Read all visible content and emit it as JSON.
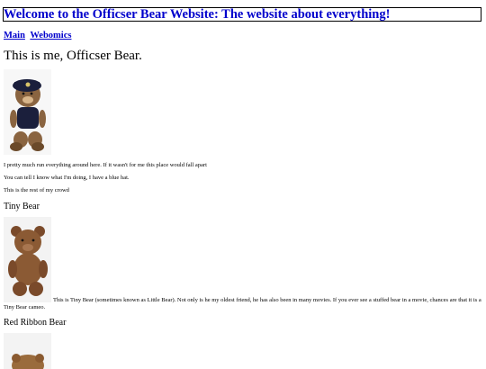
{
  "header": {
    "title": "Welcome to the Officser Bear Website: The website about everything!"
  },
  "nav": {
    "links": [
      "Main",
      "Webomics"
    ]
  },
  "intro": {
    "heading": "This is me, Officser Bear.",
    "line1": "I pretty much run everything around here. If it wasn't for me this place would fall apart",
    "line2": "You can tell I know what I'm doing, I have a blue hat.",
    "line3": "This is the rest of my crowd"
  },
  "sections": [
    {
      "heading": "Tiny Bear",
      "caption": "This is Tiny Bear (sometimes known as Little Bear). Not only is he my oldest friend, he has also been in many movies. If you ever see a stuffed bear in a movie, chances are that it is a Tiny Bear cameo."
    },
    {
      "heading": "Red Ribbon Bear"
    }
  ],
  "colors": {
    "link": "#0000cc",
    "text": "#000000",
    "background": "#ffffff"
  }
}
